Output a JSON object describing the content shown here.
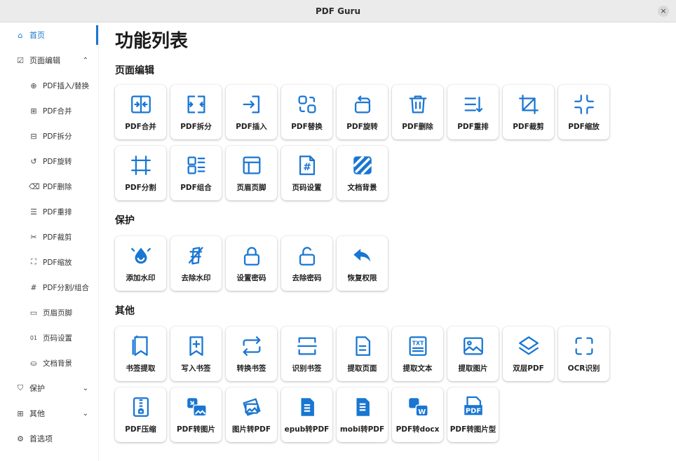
{
  "window": {
    "title": "PDF Guru",
    "close_glyph": "×"
  },
  "sidebar": {
    "home": {
      "label": "首页",
      "icon": "home-icon"
    },
    "edit_group": {
      "label": "页面编辑",
      "icon": "edit-icon",
      "expanded": true
    },
    "edit_items": [
      {
        "label": "PDF插入/替换",
        "icon": "insert-icon"
      },
      {
        "label": "PDF合并",
        "icon": "merge-icon"
      },
      {
        "label": "PDF拆分",
        "icon": "split-icon"
      },
      {
        "label": "PDF旋转",
        "icon": "rotate-icon"
      },
      {
        "label": "PDF删除",
        "icon": "trash-icon"
      },
      {
        "label": "PDF重排",
        "icon": "reorder-icon"
      },
      {
        "label": "PDF裁剪",
        "icon": "scissors-icon"
      },
      {
        "label": "PDF缩放",
        "icon": "scale-icon"
      },
      {
        "label": "PDF分割/组合",
        "icon": "hash-icon"
      },
      {
        "label": "页眉页脚",
        "icon": "header-footer-icon"
      },
      {
        "label": "页码设置",
        "icon": "page-number-icon"
      },
      {
        "label": "文档背景",
        "icon": "background-icon"
      }
    ],
    "protect": {
      "label": "保护",
      "icon": "shield-icon"
    },
    "other": {
      "label": "其他",
      "icon": "grid-icon"
    },
    "preferences": {
      "label": "首选项",
      "icon": "gear-icon"
    }
  },
  "main": {
    "title": "功能列表",
    "sections": [
      {
        "title": "页面编辑",
        "cards": [
          {
            "label": "PDF合并",
            "icon": "merge-icon"
          },
          {
            "label": "PDF拆分",
            "icon": "split-icon"
          },
          {
            "label": "PDF插入",
            "icon": "insert-icon"
          },
          {
            "label": "PDF替换",
            "icon": "replace-icon"
          },
          {
            "label": "PDF旋转",
            "icon": "rotate-icon"
          },
          {
            "label": "PDF删除",
            "icon": "trash-icon"
          },
          {
            "label": "PDF重排",
            "icon": "reorder-icon"
          },
          {
            "label": "PDF裁剪",
            "icon": "crop-icon"
          },
          {
            "label": "PDF缩放",
            "icon": "scale-icon"
          },
          {
            "label": "PDF分割",
            "icon": "cut-frame-icon"
          },
          {
            "label": "PDF组合",
            "icon": "combine-icon"
          },
          {
            "label": "页眉页脚",
            "icon": "header-footer-icon"
          },
          {
            "label": "页码设置",
            "icon": "page-number-icon"
          },
          {
            "label": "文档背景",
            "icon": "background-icon"
          }
        ]
      },
      {
        "title": "保护",
        "cards": [
          {
            "label": "添加水印",
            "icon": "watermark-add-icon"
          },
          {
            "label": "去除水印",
            "icon": "watermark-remove-icon"
          },
          {
            "label": "设置密码",
            "icon": "lock-icon"
          },
          {
            "label": "去除密码",
            "icon": "unlock-icon"
          },
          {
            "label": "恢复权限",
            "icon": "undo-arrow-icon"
          }
        ]
      },
      {
        "title": "其他",
        "cards": [
          {
            "label": "书签提取",
            "icon": "bookmarks-icon"
          },
          {
            "label": "写入书签",
            "icon": "bookmark-add-icon"
          },
          {
            "label": "转换书签",
            "icon": "convert-icon"
          },
          {
            "label": "识别书签",
            "icon": "scan-icon"
          },
          {
            "label": "提取页面",
            "icon": "extract-page-icon"
          },
          {
            "label": "提取文本",
            "icon": "text-file-icon"
          },
          {
            "label": "提取图片",
            "icon": "image-icon"
          },
          {
            "label": "双层PDF",
            "icon": "layers-icon"
          },
          {
            "label": "OCR识别",
            "icon": "ocr-icon"
          },
          {
            "label": "PDF压缩",
            "icon": "zip-icon"
          },
          {
            "label": "PDF转图片",
            "icon": "pdf-to-image-icon"
          },
          {
            "label": "图片转PDF",
            "icon": "image-to-pdf-icon"
          },
          {
            "label": "epub转PDF",
            "icon": "epub-icon"
          },
          {
            "label": "mobi转PDF",
            "icon": "mobi-icon"
          },
          {
            "label": "PDF转docx",
            "icon": "pdf-to-word-icon"
          },
          {
            "label": "PDF转图片型",
            "icon": "pdf-to-imagepdf-icon"
          }
        ]
      }
    ],
    "icon_text": {
      "txt": "TXT",
      "word": "W",
      "pdf": "PDF",
      "hash": "#"
    }
  },
  "colors": {
    "accent": "#1976d2",
    "sidebar_active_text": "#1976d2",
    "titlebar": "#ebebeb"
  }
}
